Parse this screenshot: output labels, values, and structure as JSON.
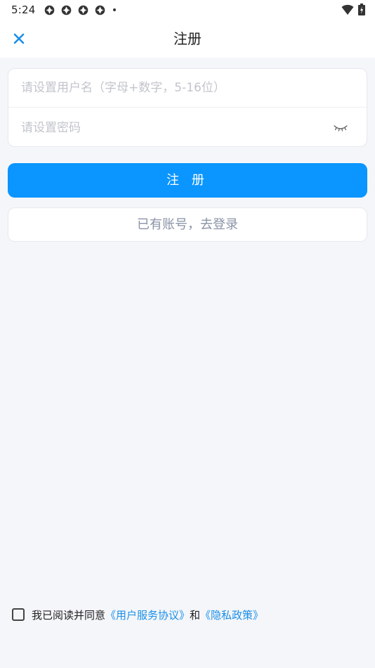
{
  "status_bar": {
    "time": "5:24",
    "notification_icons": [
      "app-icon",
      "app-icon",
      "app-icon",
      "app-icon"
    ],
    "wifi": "wifi-icon",
    "battery": "battery-icon"
  },
  "header": {
    "close_icon": "close-icon",
    "title": "注册",
    "accent_color": "#1a8fe8"
  },
  "form": {
    "username": {
      "value": "",
      "placeholder": "请设置用户名（字母+数字，5-16位）"
    },
    "password": {
      "value": "",
      "placeholder": "请设置密码",
      "toggle_icon": "eye-closed-icon"
    }
  },
  "buttons": {
    "register_label": "注 册",
    "login_label": "已有账号，去登录",
    "primary_color": "#0b95ff"
  },
  "agreement": {
    "checked": false,
    "prefix": "我已阅读并同意",
    "terms_link": "《用户服务协议》",
    "and": "和",
    "privacy_link": "《隐私政策》"
  }
}
